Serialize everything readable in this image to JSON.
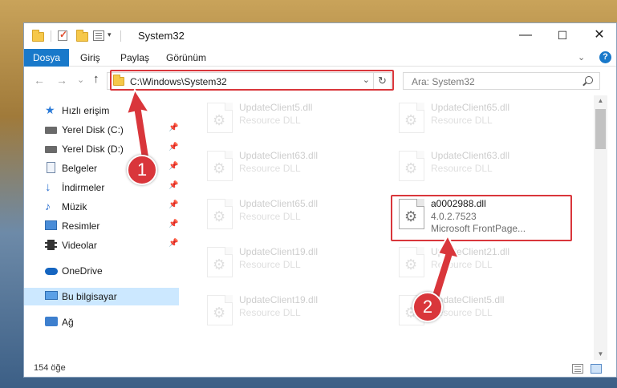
{
  "window": {
    "title": "System32",
    "controls": {
      "minimize": "—",
      "maximize": "☐",
      "close": "✕"
    }
  },
  "ribbon": {
    "tabs": [
      "Dosya",
      "Giriş",
      "Paylaş",
      "Görünüm"
    ],
    "expand": "⌄",
    "help": "?"
  },
  "navigation": {
    "back": "←",
    "forward": "→",
    "recent": "⌄",
    "up": "↑",
    "address": "C:\\Windows\\System32",
    "address_dropdown": "⌄",
    "refresh": "↻",
    "search_placeholder": "Ara: System32"
  },
  "sidebar": {
    "items": [
      {
        "label": "Hızlı erişim",
        "icon": "star-icon",
        "pinned": false
      },
      {
        "label": "Yerel Disk (C:)",
        "icon": "disk-icon",
        "pinned": true
      },
      {
        "label": "Yerel Disk (D:)",
        "icon": "disk-icon",
        "pinned": true
      },
      {
        "label": "Belgeler",
        "icon": "document-icon",
        "pinned": true
      },
      {
        "label": "İndirmeler",
        "icon": "download-icon",
        "pinned": true
      },
      {
        "label": "Müzik",
        "icon": "music-icon",
        "pinned": true
      },
      {
        "label": "Resimler",
        "icon": "pictures-icon",
        "pinned": true
      },
      {
        "label": "Videolar",
        "icon": "video-icon",
        "pinned": true
      },
      {
        "label": "OneDrive",
        "icon": "onedrive-icon",
        "pinned": false
      },
      {
        "label": "Bu bilgisayar",
        "icon": "computer-icon",
        "pinned": false,
        "selected": true
      },
      {
        "label": "Ağ",
        "icon": "network-icon",
        "pinned": false
      }
    ],
    "pin_glyph": "📌"
  },
  "files": [
    {
      "name": "UpdateClient5.dll",
      "type": "Resource DLL",
      "faded": true
    },
    {
      "name": "UpdateClient65.dll",
      "type": "Resource DLL",
      "faded": true
    },
    {
      "name": "UpdateClient63.dll",
      "type": "Resource DLL",
      "faded": true
    },
    {
      "name": "UpdateClient63.dll",
      "type": "Resource DLL",
      "faded": true
    },
    {
      "name": "UpdateClient65.dll",
      "type": "Resource DLL",
      "faded": true
    },
    {
      "name": "a0002988.dll",
      "version": "4.0.2.7523",
      "company": "Microsoft FrontPage...",
      "faded": false,
      "highlighted": true
    },
    {
      "name": "UpdateClient19.dll",
      "type": "Resource DLL",
      "faded": true
    },
    {
      "name": "UpdateClient21.dll",
      "type": "Resource DLL",
      "faded": true
    },
    {
      "name": "UpdateClient19.dll",
      "type": "Resource DLL",
      "faded": true
    },
    {
      "name": "UpdateClient5.dll",
      "type": "Resource DLL",
      "faded": true
    }
  ],
  "status": {
    "item_count": "154 öğe"
  },
  "annotations": [
    {
      "label": "1",
      "color": "#d9363b"
    },
    {
      "label": "2",
      "color": "#d9363b"
    }
  ]
}
